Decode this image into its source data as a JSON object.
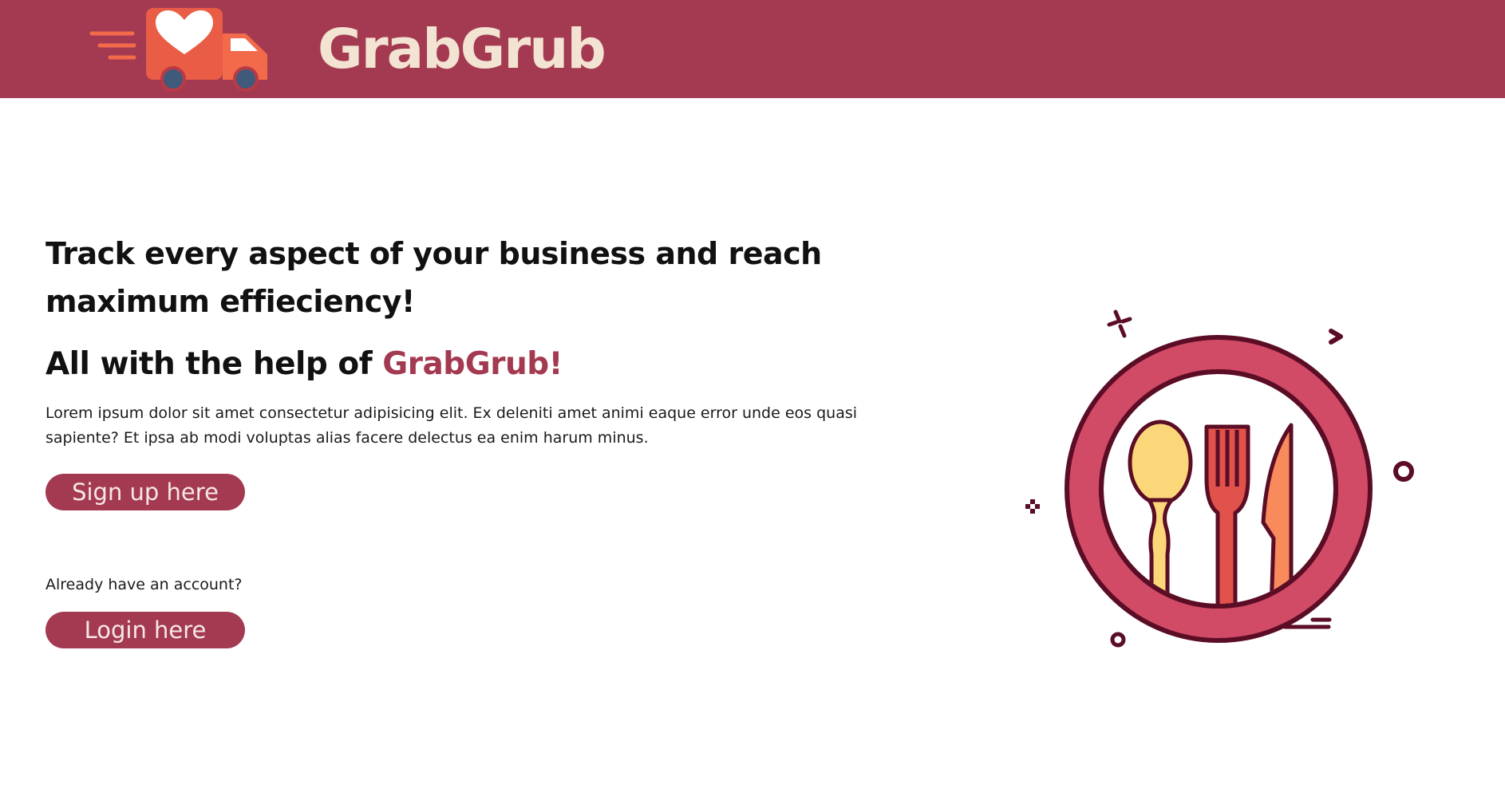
{
  "header": {
    "brand": "GrabGrub",
    "logo_icon": "delivery-truck-heart-icon",
    "background_color": "#a43a51",
    "brand_color": "#f3e3d2"
  },
  "hero": {
    "headline": "Track every aspect of your business and reach maximum effieciency!",
    "subheadline_prefix": "All with the help of ",
    "subheadline_brand": "GrabGrub!",
    "description": "Lorem ipsum dolor sit amet consectetur adipisicing elit. Ex deleniti amet animi eaque error unde eos quasi sapiente? Et ipsa ab modi voluptas alias facere delectus ea enim harum minus.",
    "signup_label": "Sign up here",
    "already_text": "Already have an account?",
    "login_label": "Login here",
    "accent_color": "#a43a51"
  },
  "illustration": {
    "icon": "plate-cutlery-icon",
    "colors": {
      "plate_ring": "#d14b67",
      "outline": "#5b0d25",
      "spoon": "#fcd77a",
      "fork": "#e0524a",
      "knife": "#f88a5c"
    }
  }
}
